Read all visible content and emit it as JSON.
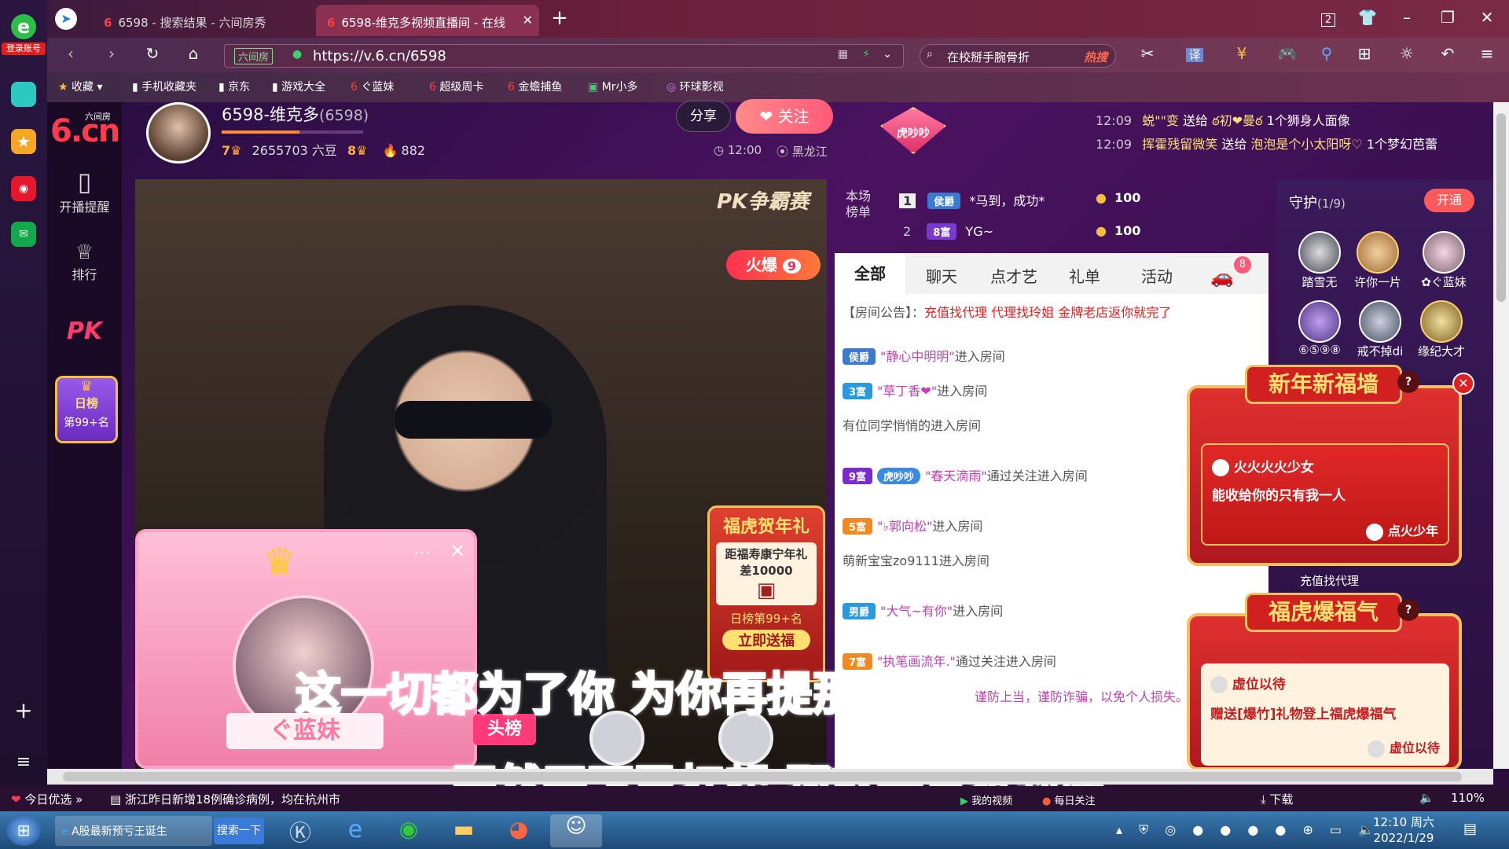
{
  "browser": {
    "login_label": "登录账号",
    "tabs": [
      {
        "label": "6598 - 搜索结果 - 六间房秀",
        "active": false
      },
      {
        "label": "6598-维克多视频直播间 - 在线",
        "active": true
      }
    ],
    "url_badge": "六间房",
    "url": "https://v.6.cn/6598",
    "search_text": "在校掰手腕骨折",
    "search_tag": "热搜",
    "translate_label": "译",
    "window_count": "2",
    "bookmarks": [
      "收藏",
      "手机收藏夹",
      "京东",
      "游戏大全",
      "ぐ蓝妹",
      "超级周卡",
      "金蟾捕鱼",
      "Mr小多",
      "环球影视"
    ]
  },
  "sidebar": {
    "logo_small": "六间房",
    "logo_big": "6.cn",
    "items": [
      "开播提醒",
      "排行"
    ],
    "pk_label": "PK",
    "daily_badge_title": "日榜",
    "daily_badge_rank": "第99+名"
  },
  "anchor": {
    "name": "6598-维克多",
    "room_id": "(6598)",
    "level": "7",
    "beans": "2655703 六豆",
    "wealth_level": "8",
    "fans": "882",
    "share_label": "分享",
    "follow_label": "关注",
    "time": "12:00",
    "location": "黑龙江"
  },
  "gift_feed": [
    {
      "time": "12:09",
      "from": "蜕\"\"变",
      "verb": "送给",
      "to": "ఠ初❤曼ఠ",
      "gift": "1个狮身人面像"
    },
    {
      "time": "12:09",
      "from": "挥霍残留微笑",
      "verb": "送给",
      "to": "泡泡是个小太阳呀♡",
      "gift": "1个梦幻芭蕾"
    }
  ],
  "tiger_badge": "虎吵吵",
  "rank_board": {
    "label": "本场榜单",
    "rows": [
      {
        "rank": "1",
        "badge": "侯爵",
        "name": "*马到，成功*",
        "score": "100"
      },
      {
        "rank": "2",
        "badge": "8富",
        "name": "YG~",
        "score": "100"
      }
    ]
  },
  "chat_tabs": [
    "全部",
    "聊天",
    "点才艺",
    "礼单",
    "活动"
  ],
  "car_count": "8",
  "announcement": {
    "label": "【房间公告】：",
    "text": "充值找代理 代理找玲姐 金牌老店返你就完了"
  },
  "chat": [
    {
      "badge": "侯爵",
      "name": "\"静心中明明\"",
      "text": "进入房间"
    },
    {
      "badge": "3富",
      "name": "\"草丁香❤\"",
      "text": "进入房间"
    },
    {
      "badge": "",
      "name": "",
      "text": "有位同学悄悄的进入房间"
    },
    {
      "badge": "9富",
      "extra": "虎吵吵",
      "name": "\"春天滴雨\"",
      "text": "通过关注进入房间"
    },
    {
      "badge": "5富",
      "name": "\"♭郭向松\"",
      "text": "进入房间"
    },
    {
      "badge": "",
      "name": "",
      "text": "萌新宝宝zo9111进入房间"
    },
    {
      "badge": "男爵",
      "name": "\"大气~有你\"",
      "text": "进入房间"
    },
    {
      "badge": "7富",
      "name": "\"执笔画流年.\"",
      "text": "通过关注进入房间"
    }
  ],
  "warning_tail": "谨防上当，谨防诈骗，以免个人损失。",
  "guard": {
    "title": "守护",
    "count": "(1/9)",
    "open_label": "开通",
    "members": [
      "踏雪无",
      "许你一片",
      "✿ぐ蓝妹",
      "⑥⑤⑨⑧",
      "戒不掉di",
      "缘纪大才"
    ]
  },
  "video": {
    "pk_label": "PK争霸赛",
    "hot_label": "火爆",
    "hot_count": "9",
    "promo_title": "福虎贺年礼",
    "promo_line1": "距福寿康宁年礼",
    "promo_line2": "差10000",
    "promo_rank": "日榜第99+名",
    "promo_button": "立即送福",
    "lyric_line1": "这一切都为了你  为你再提那手中笔",
    "lyric_line2": "既然天下已扛起  那就一直抗到底",
    "mini_card_name": "ぐ蓝妹",
    "banner_label": "头榜"
  },
  "popup1": {
    "title": "新年新福墙",
    "user": "火火火火少女",
    "message": "能收给你的只有我一人",
    "signature": "点火少年"
  },
  "popup2": {
    "title": "福虎爆福气",
    "user": "虚位以待",
    "message": "赠送[爆竹]礼物登上福虎爆福气",
    "signature": "虚位以待",
    "behind_text": "充值找代理"
  },
  "statusbar": {
    "left_label": "今日优选",
    "news": "浙江昨日新增18例确诊病例，均在杭州市",
    "my_video": "我的视频",
    "daily_follow": "每日关注",
    "download": "下载",
    "zoom": "110%"
  },
  "taskbar": {
    "ie_task": "A股最新预亏王诞生",
    "search_btn": "搜索一下",
    "time": "12:10 周六",
    "date": "2022/1/29"
  },
  "colors": {
    "accent": "#ff5a7a",
    "chat_pink": "#c23fb4",
    "notice_red": "#e02020"
  }
}
